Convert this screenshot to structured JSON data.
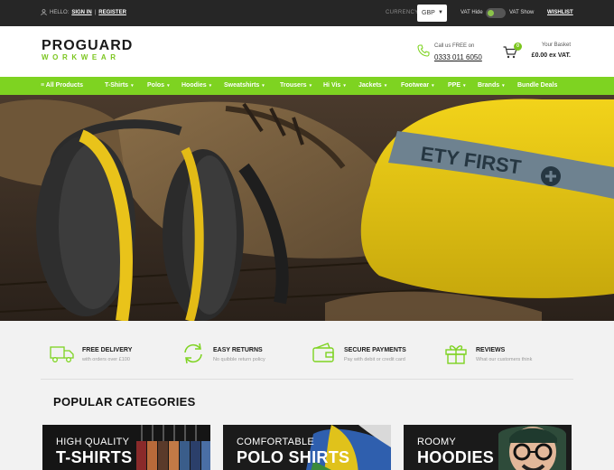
{
  "topbar": {
    "hello": "HELLO:",
    "sign_in": "SIGN IN",
    "separator": "|",
    "register": "REGISTER",
    "currency_label": "CURRENCY",
    "currency_value": "GBP",
    "vat_hide": "VAT Hide",
    "vat_show": "VAT Show",
    "wishlist": "WISHLIST"
  },
  "header": {
    "logo_line1": "PROGUARD",
    "logo_line2": "WORKWEAR",
    "call_text": "Call us FREE on",
    "phone_number": "0333 011 6050",
    "basket_count": "0",
    "basket_title": "Your Basket",
    "basket_total": "£0.00 ex VAT."
  },
  "nav": {
    "items": [
      {
        "label": "All Products"
      },
      {
        "label": "T-Shirts"
      },
      {
        "label": "Polos"
      },
      {
        "label": "Hoodies"
      },
      {
        "label": "Sweatshirts"
      },
      {
        "label": "Trousers"
      },
      {
        "label": "Hi Vis"
      },
      {
        "label": "Jackets"
      },
      {
        "label": "Footwear"
      },
      {
        "label": "PPE"
      },
      {
        "label": "Brands"
      },
      {
        "label": "Bundle Deals"
      }
    ]
  },
  "hero": {
    "helmet_text": "ETY FIRST"
  },
  "features": [
    {
      "title": "FREE DELIVERY",
      "subtitle": "with orders over £100",
      "icon": "truck-icon"
    },
    {
      "title": "EASY RETURNS",
      "subtitle": "No quibble return policy",
      "icon": "refresh-icon"
    },
    {
      "title": "SECURE PAYMENTS",
      "subtitle": "Pay with debit or credit card",
      "icon": "wallet-icon"
    },
    {
      "title": "REVIEWS",
      "subtitle": "What our customers think",
      "icon": "gift-icon"
    }
  ],
  "popular": {
    "title": "POPULAR CATEGORIES",
    "categories": [
      {
        "line1": "HIGH QUALITY",
        "line2": "T-SHIRTS"
      },
      {
        "line1": "COMFORTABLE",
        "line2": "POLO SHIRTS"
      },
      {
        "line1": "ROOMY",
        "line2": "HOODIES"
      }
    ]
  },
  "colors": {
    "accent": "#7ed321",
    "topbar": "#262626"
  }
}
